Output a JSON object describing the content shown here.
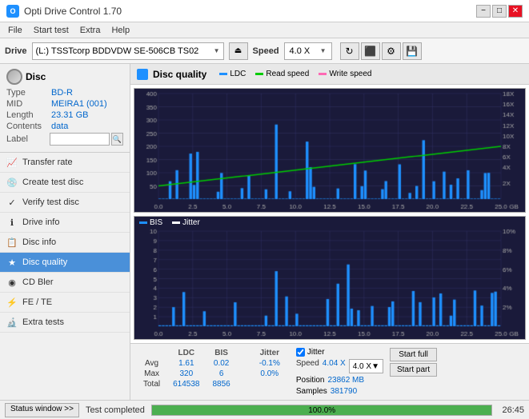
{
  "app": {
    "title": "Opti Drive Control 1.70",
    "icon": "O"
  },
  "titlebar": {
    "minimize": "−",
    "maximize": "□",
    "close": "✕"
  },
  "menu": {
    "items": [
      "File",
      "Start test",
      "Extra",
      "Help"
    ]
  },
  "drivebar": {
    "drive_label": "Drive",
    "drive_value": "(L:) TSSTcorp BDDVDW SE-506CB TS02",
    "speed_label": "Speed",
    "speed_value": "4.0 X"
  },
  "disc": {
    "section_label": "Disc",
    "type_label": "Type",
    "type_value": "BD-R",
    "mid_label": "MID",
    "mid_value": "MEIRA1 (001)",
    "length_label": "Length",
    "length_value": "23.31 GB",
    "contents_label": "Contents",
    "contents_value": "data",
    "label_label": "Label"
  },
  "sidebar": {
    "items": [
      {
        "id": "transfer-rate",
        "label": "Transfer rate",
        "icon": "📈"
      },
      {
        "id": "create-test-disc",
        "label": "Create test disc",
        "icon": "💿"
      },
      {
        "id": "verify-test-disc",
        "label": "Verify test disc",
        "icon": "✓"
      },
      {
        "id": "drive-info",
        "label": "Drive info",
        "icon": "ℹ"
      },
      {
        "id": "disc-info",
        "label": "Disc info",
        "icon": "📋"
      },
      {
        "id": "disc-quality",
        "label": "Disc quality",
        "icon": "★",
        "active": true
      },
      {
        "id": "cd-bler",
        "label": "CD Bler",
        "icon": "◉"
      },
      {
        "id": "fe-te",
        "label": "FE / TE",
        "icon": "⚡"
      },
      {
        "id": "extra-tests",
        "label": "Extra tests",
        "icon": "🔬"
      }
    ]
  },
  "panel": {
    "title": "Disc quality",
    "icon_color": "#1e90ff",
    "legend": [
      {
        "label": "LDC",
        "color": "#1e90ff"
      },
      {
        "label": "Read speed",
        "color": "#00cc00"
      },
      {
        "label": "Write speed",
        "color": "#ff69b4"
      }
    ],
    "legend2": [
      {
        "label": "BIS",
        "color": "#1e90ff"
      },
      {
        "label": "Jitter",
        "color": "#ffffff"
      }
    ]
  },
  "stats": {
    "headers": [
      "LDC",
      "BIS",
      "",
      "Jitter",
      "Speed",
      ""
    ],
    "avg_label": "Avg",
    "avg_ldc": "1.61",
    "avg_bis": "0.02",
    "avg_jitter": "-0.1%",
    "max_label": "Max",
    "max_ldc": "320",
    "max_bis": "6",
    "max_jitter": "0.0%",
    "total_label": "Total",
    "total_ldc": "614538",
    "total_bis": "8856",
    "jitter_checked": true,
    "jitter_label": "Jitter",
    "speed_label": "Speed",
    "speed_value": "4.04 X",
    "speed_select": "4.0 X",
    "position_label": "Position",
    "position_value": "23862 MB",
    "samples_label": "Samples",
    "samples_value": "381790",
    "btn_start_full": "Start full",
    "btn_start_part": "Start part"
  },
  "statusbar": {
    "status_window_label": "Status window >>",
    "status_text": "Test completed",
    "progress_percent": 100,
    "progress_display": "100.0%",
    "time": "26:45"
  }
}
